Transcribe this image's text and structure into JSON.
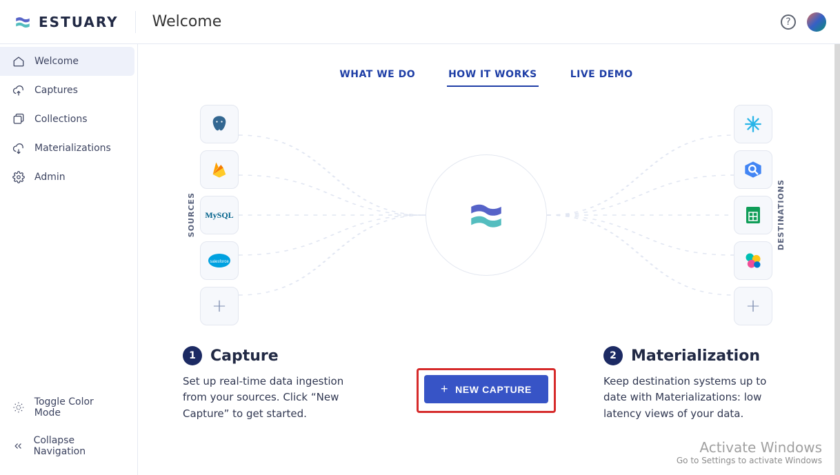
{
  "brand": {
    "name": "ESTUARY"
  },
  "page_title": "Welcome",
  "sidebar": {
    "items": [
      {
        "label": "Welcome"
      },
      {
        "label": "Captures"
      },
      {
        "label": "Collections"
      },
      {
        "label": "Materializations"
      },
      {
        "label": "Admin"
      }
    ],
    "footer": {
      "toggle_color": "Toggle Color Mode",
      "collapse": "Collapse Navigation"
    }
  },
  "tabs": [
    {
      "label": "WHAT WE DO"
    },
    {
      "label": "HOW IT WORKS"
    },
    {
      "label": "LIVE DEMO"
    }
  ],
  "active_tab_index": 1,
  "diagram": {
    "sources_label": "SOURCES",
    "destinations_label": "DESTINATIONS",
    "source_tiles": [
      "postgres-icon",
      "firebase-icon",
      "mysql-icon",
      "salesforce-icon"
    ],
    "destination_tiles": [
      "snowflake-icon",
      "bigquery-icon",
      "google-sheets-icon",
      "elastic-icon"
    ],
    "add_source_label": "+",
    "add_destination_label": "+"
  },
  "steps": {
    "capture": {
      "number": "1",
      "title": "Capture",
      "desc": "Set up real-time data ingestion from your sources. Click “New Capture” to get started."
    },
    "materialization": {
      "number": "2",
      "title": "Materialization",
      "desc": "Keep destination systems up to date with Materializations: low latency views of your data."
    },
    "cta_label": "NEW CAPTURE"
  },
  "watermark": {
    "line1": "Activate Windows",
    "line2": "Go to Settings to activate Windows"
  }
}
